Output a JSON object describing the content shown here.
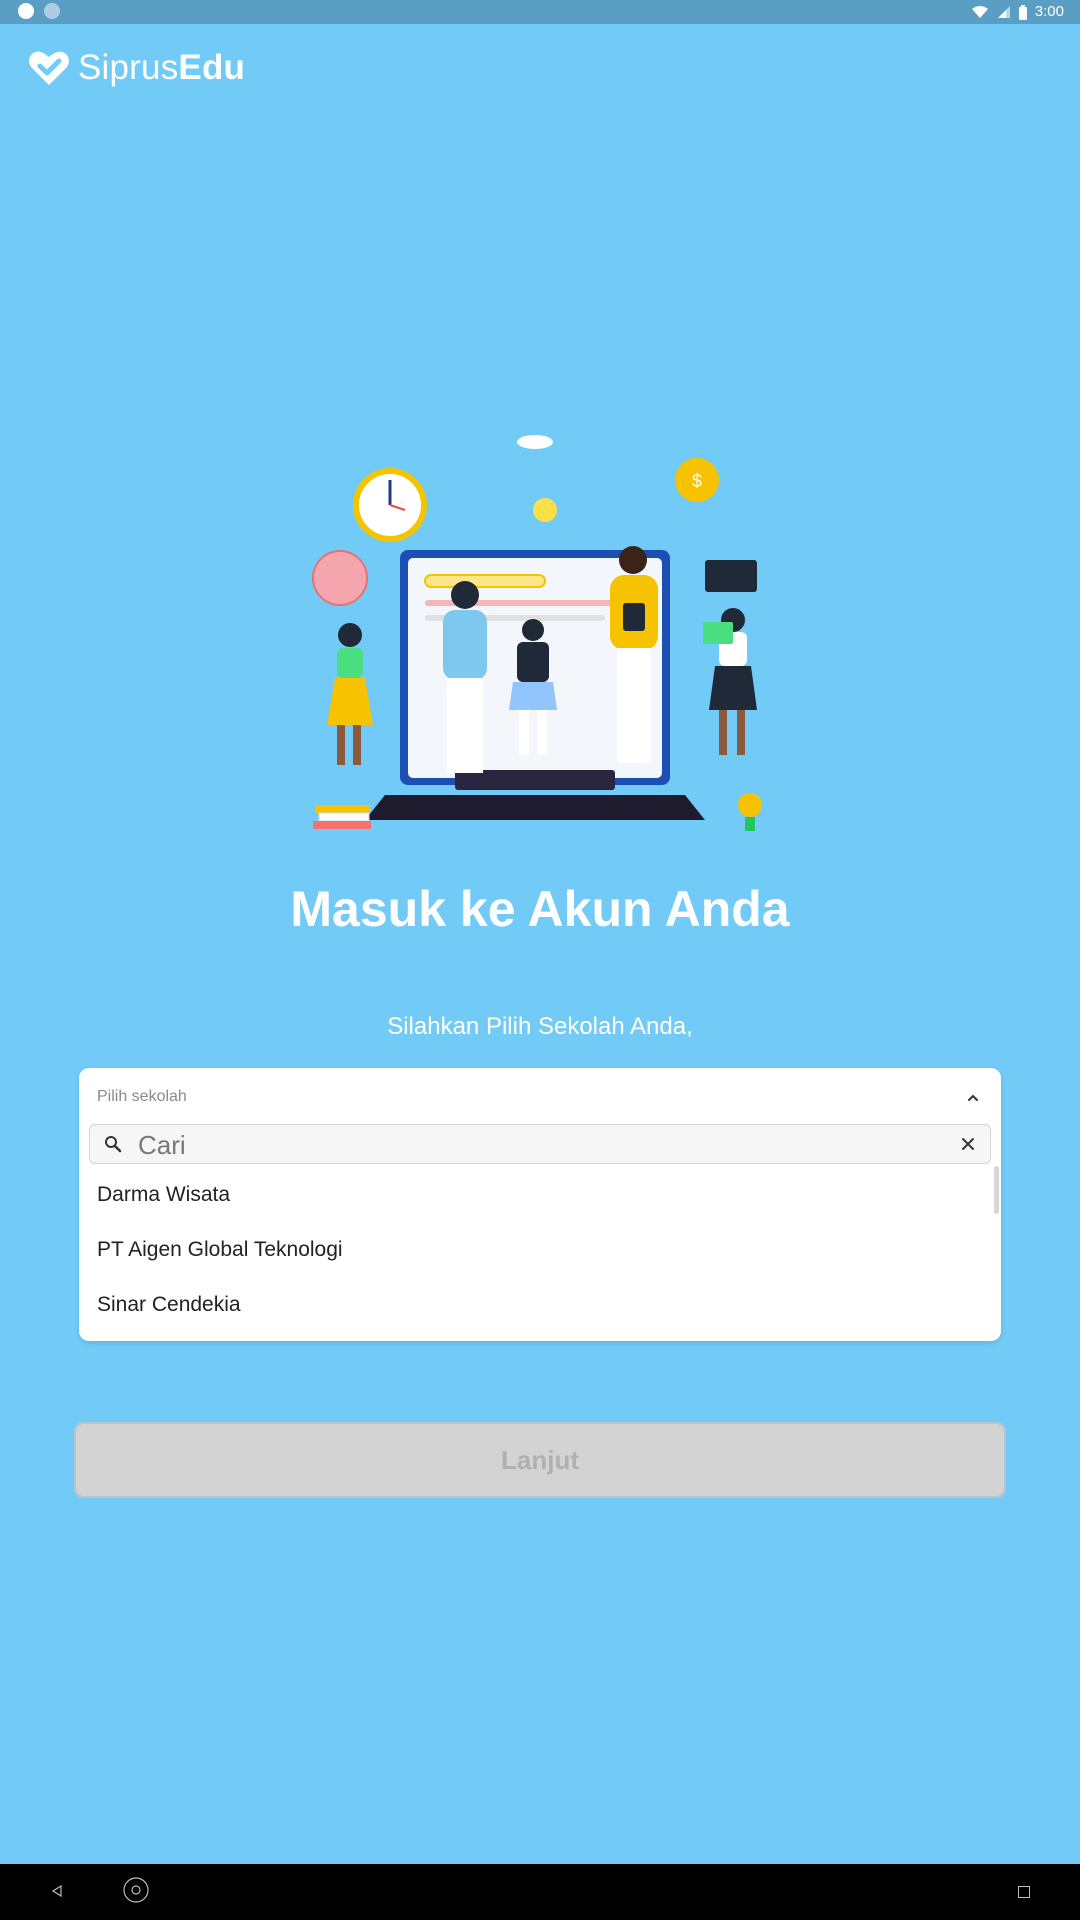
{
  "status_bar": {
    "time": "3:00"
  },
  "brand": {
    "name_light": "Siprus",
    "name_bold": "Edu",
    "icon": "heart-check-logo-icon"
  },
  "hero": {
    "icon": "education-illustration"
  },
  "page": {
    "title": "Masuk ke Akun Anda",
    "subtitle": "Silahkan Pilih Sekolah Anda,"
  },
  "dropdown": {
    "label": "Pilih sekolah",
    "search_placeholder": "Cari",
    "search_value": "",
    "options": [
      "Darma Wisata",
      "PT Aigen Global Teknologi",
      "Sinar Cendekia"
    ]
  },
  "actions": {
    "continue_label": "Lanjut"
  },
  "colors": {
    "background": "#71cbf6",
    "status_bar": "#5a9fc3",
    "button_disabled": "#d3d3d3"
  }
}
